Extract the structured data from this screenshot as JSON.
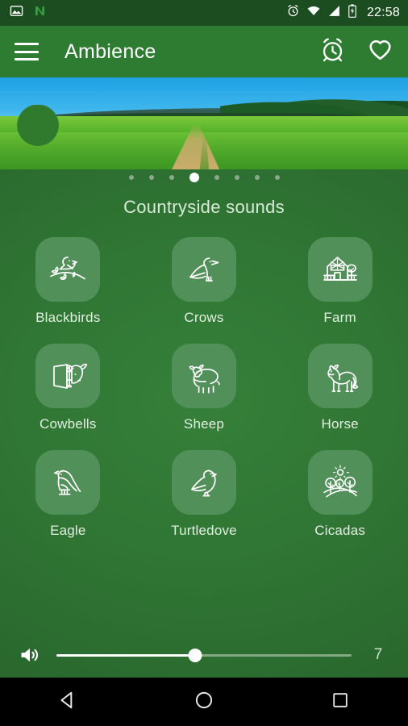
{
  "statusbar": {
    "time": "22:58",
    "icons": [
      "image-icon",
      "nfc-n-icon",
      "alarm-icon",
      "wifi-icon",
      "signal-icon",
      "battery-icon"
    ]
  },
  "appbar": {
    "menu_icon": "hamburger-menu-icon",
    "title": "Ambience",
    "actions": [
      {
        "name": "timer-alarm-button",
        "icon": "alarm-clock-icon"
      },
      {
        "name": "favorite-button",
        "icon": "heart-outline-icon"
      }
    ]
  },
  "hero": {
    "alt": "countryside meadow with dirt path banner"
  },
  "pager": {
    "total": 8,
    "active_index": 3
  },
  "main": {
    "section_title": "Countryside sounds",
    "sounds": [
      {
        "label": "Blackbirds",
        "icon": "bird-on-branch-icon"
      },
      {
        "label": "Crows",
        "icon": "crow-icon"
      },
      {
        "label": "Farm",
        "icon": "barn-farm-icon"
      },
      {
        "label": "Cowbells",
        "icon": "cow-head-bell-icon"
      },
      {
        "label": "Sheep",
        "icon": "sheep-icon"
      },
      {
        "label": "Horse",
        "icon": "horse-icon"
      },
      {
        "label": "Eagle",
        "icon": "eagle-icon"
      },
      {
        "label": "Turtledove",
        "icon": "dove-icon"
      },
      {
        "label": "Cicadas",
        "icon": "trees-sun-hills-icon"
      }
    ]
  },
  "volume": {
    "icon": "speaker-volume-icon",
    "value": "7",
    "percent": 47
  },
  "navbar": {
    "buttons": [
      {
        "name": "back-button",
        "icon": "triangle-back-icon"
      },
      {
        "name": "home-button",
        "icon": "circle-home-icon"
      },
      {
        "name": "recents-button",
        "icon": "square-recents-icon"
      }
    ]
  },
  "colors": {
    "statusbar_bg": "#1b4d20",
    "appbar_bg": "#2d7c31",
    "content_bg": "#2f7433",
    "tile_bg": "#52905a",
    "accent_white": "#ffffff"
  }
}
